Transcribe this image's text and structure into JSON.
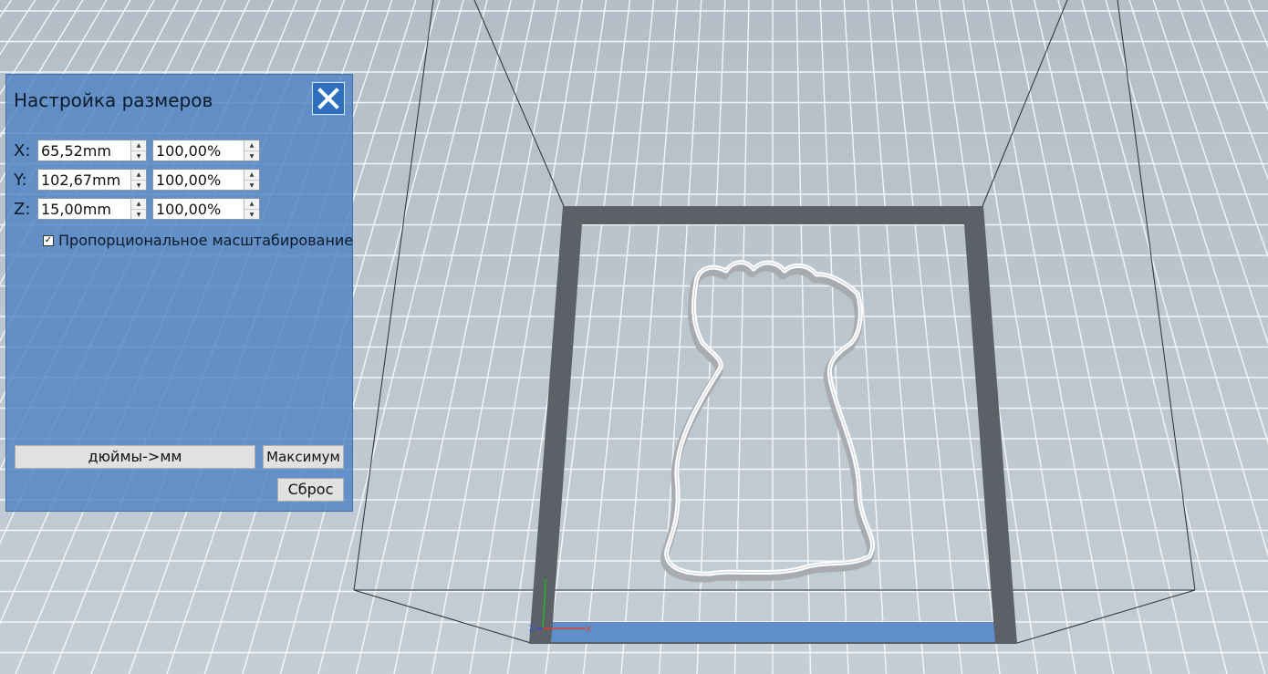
{
  "panel": {
    "title": "Настройка размеров",
    "close_icon": "close-icon",
    "rows": [
      {
        "axis": "X:",
        "size": "65,52mm",
        "percent": "100,00%"
      },
      {
        "axis": "Y:",
        "size": "102,67mm",
        "percent": "100,00%"
      },
      {
        "axis": "Z:",
        "size": "15,00mm",
        "percent": "100,00%"
      }
    ],
    "proportional": {
      "checked": true,
      "label": "Пропорциональное масштабирование"
    },
    "buttons": {
      "inch_to_mm": "дюймы->мм",
      "maximum": "Максимум",
      "reset": "Сброс"
    }
  },
  "scene": {
    "axis_labels": {
      "x": "X",
      "y": "Y",
      "z": "Z"
    },
    "colors": {
      "background": "#b9c4cc",
      "grid": "#ffffff",
      "plate_border": "#5c6168",
      "front_edge": "#5f8ecb",
      "panel": "#4e84c4"
    }
  }
}
